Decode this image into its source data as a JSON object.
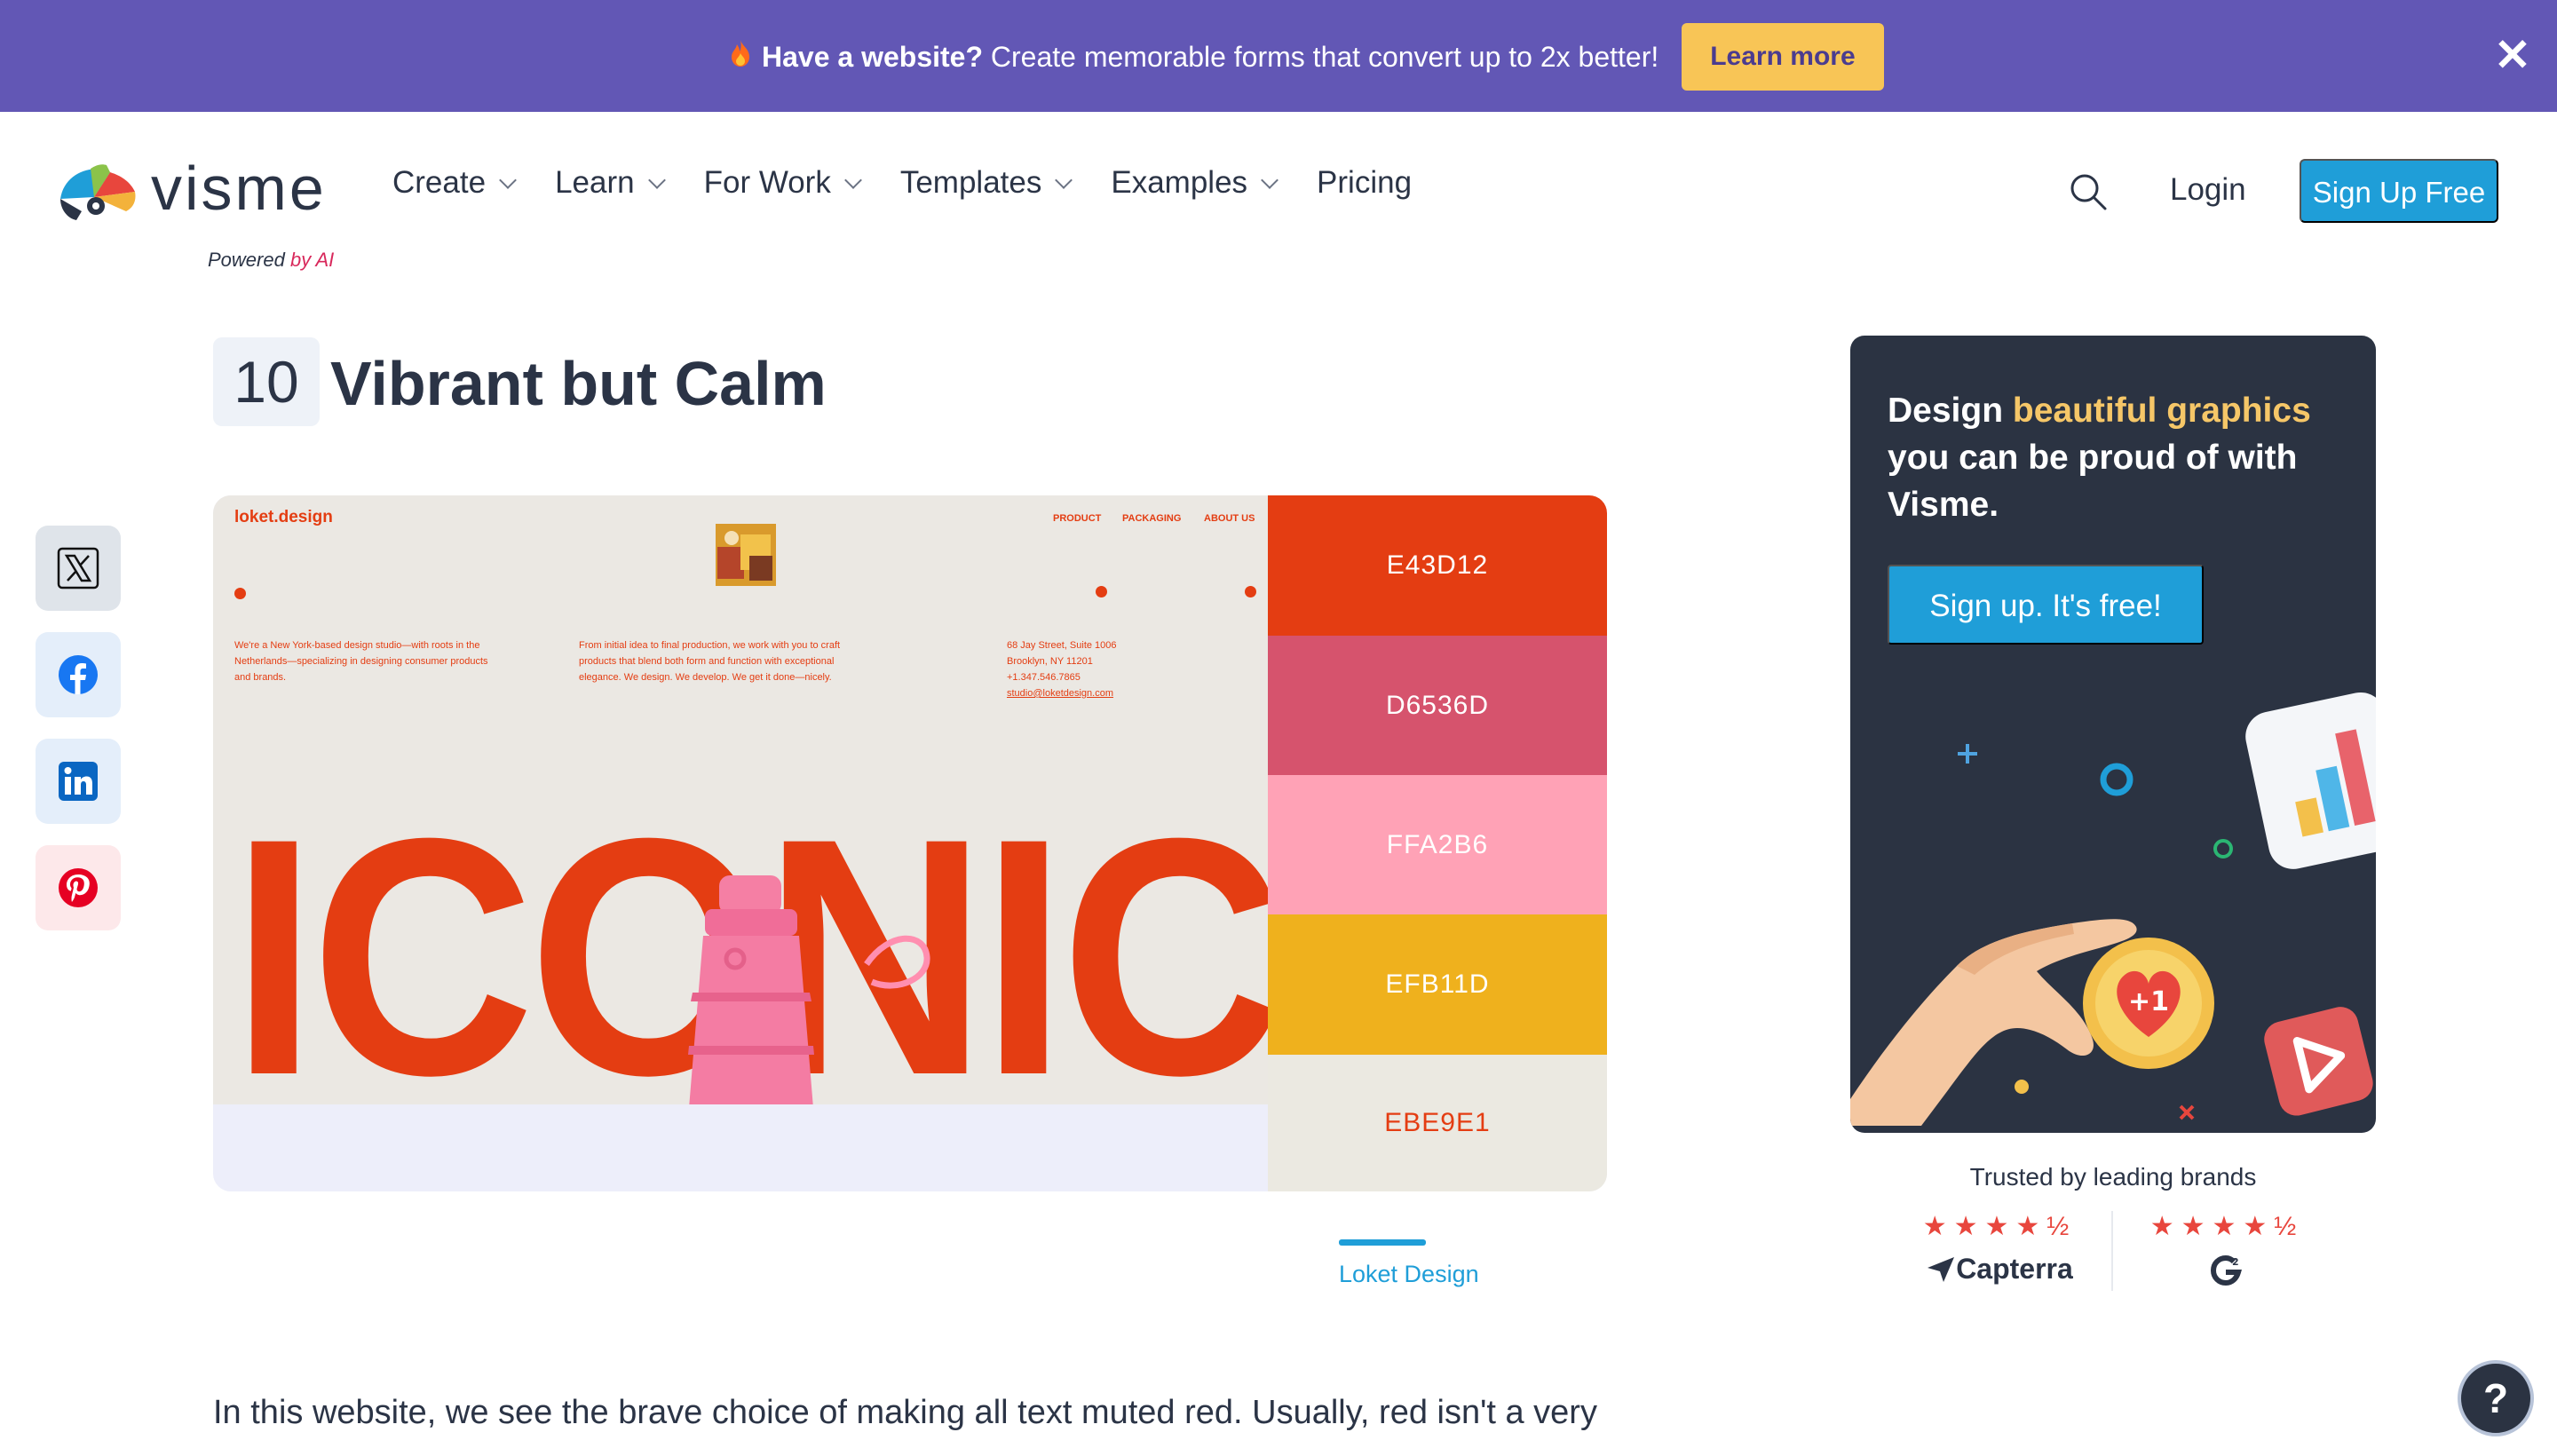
{
  "banner": {
    "icon": "fire-icon",
    "bold_text": "Have a website?",
    "text": " Create memorable forms that convert up to 2x better!",
    "button_label": "Learn more",
    "close_label": "✕",
    "background": "#6257b5",
    "button_color": "#f8c556"
  },
  "header": {
    "logo_text": "visme",
    "logo_tag_prefix": "Powered ",
    "logo_tag_suffix": "by AI",
    "nav": [
      {
        "label": "Create",
        "has_dropdown": true
      },
      {
        "label": "Learn",
        "has_dropdown": true
      },
      {
        "label": "For Work",
        "has_dropdown": true
      },
      {
        "label": "Templates",
        "has_dropdown": true
      },
      {
        "label": "Examples",
        "has_dropdown": true
      },
      {
        "label": "Pricing",
        "has_dropdown": false
      }
    ],
    "search_icon": "search-icon",
    "login_label": "Login",
    "signup_label": "Sign Up Free",
    "accent": "#1f9ed8"
  },
  "social": [
    {
      "name": "x-twitter-icon"
    },
    {
      "name": "facebook-icon"
    },
    {
      "name": "linkedin-icon"
    },
    {
      "name": "pinterest-icon"
    }
  ],
  "section": {
    "number": "10",
    "title": "Vibrant but Calm"
  },
  "site_shot": {
    "logo": "loket.design",
    "nav": [
      "PRODUCT",
      "PACKAGING",
      "ABOUT US"
    ],
    "col1": "We're a New York-based design studio—with roots in the Netherlands—specializing in designing consumer products and brands.",
    "col2": "From initial idea to final production, we work with you to craft products that blend both form and function with exceptional elegance. We design. We develop. We get it done—nicely.",
    "col3_lines": [
      "68 Jay Street, Suite 1006",
      "Brooklyn, NY 11201",
      "+1.347.546.7865"
    ],
    "col3_email": "studio@loketdesign.com",
    "hero_word": "ICONIC"
  },
  "palette": [
    {
      "hex": "E43D12",
      "color": "#e43d12",
      "text_color": "#ffffff"
    },
    {
      "hex": "D6536D",
      "color": "#d6536d",
      "text_color": "#ffffff"
    },
    {
      "hex": "FFA2B6",
      "color": "#ffa2b6",
      "text_color": "#ffffff"
    },
    {
      "hex": "EFB11D",
      "color": "#efb11d",
      "text_color": "#ffffff"
    },
    {
      "hex": "EBE9E1",
      "color": "#ebe9e1",
      "text_color": "#e43d12"
    }
  ],
  "caption": "Loket Design",
  "body_text": "In this website, we see the brave choice of making all text muted red. Usually, red isn't a very",
  "ad": {
    "title_prefix": "Design ",
    "title_highlight": "beautiful graphics",
    "title_suffix": " you can be proud of with Visme.",
    "button_label": "Sign up. It's free!"
  },
  "trust": {
    "label": "Trusted by leading brands",
    "ratings": [
      {
        "stars": "★★★★½",
        "value": 4.5,
        "brand": "Capterra"
      },
      {
        "stars": "★★★★½",
        "value": 4.5,
        "brand": "G2"
      }
    ]
  },
  "help_label": "?"
}
